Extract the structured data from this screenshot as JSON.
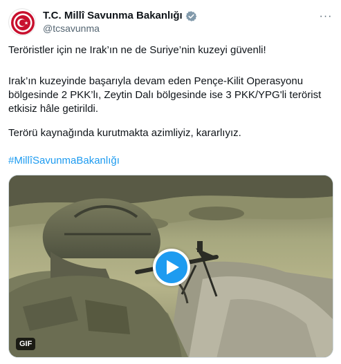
{
  "tweet": {
    "author_name": "T.C. Millî Savunma Bakanlığı",
    "handle": "@tcsavunma",
    "paragraphs": [
      "Teröristler için ne Irak’ın ne de Suriye’nin kuzeyi güvenli!",
      "Irak’ın kuzeyinde başarıyla devam eden Pençe-Kilit Operasyonu bölgesinde 2 PKK’lı, Zeytin Dalı bölgesinde ise 3 PKK/YPG'li terörist etkisiz hâle getirildi.",
      "Terörü kaynağında kurutmakta azimliyiz, kararlıyız."
    ],
    "hashtag": "#MillîSavunmaBakanlığı",
    "more_label": "···",
    "media": {
      "badge": "GIF",
      "play_icon": "play-icon"
    }
  },
  "icons": {
    "verified": "verified-badge-icon",
    "more": "more-options-icon",
    "avatar": "ministry-logo"
  },
  "colors": {
    "accent": "#1d9bf0",
    "text": "#0f1419",
    "secondary": "#536471",
    "logo_red": "#c8102e"
  }
}
